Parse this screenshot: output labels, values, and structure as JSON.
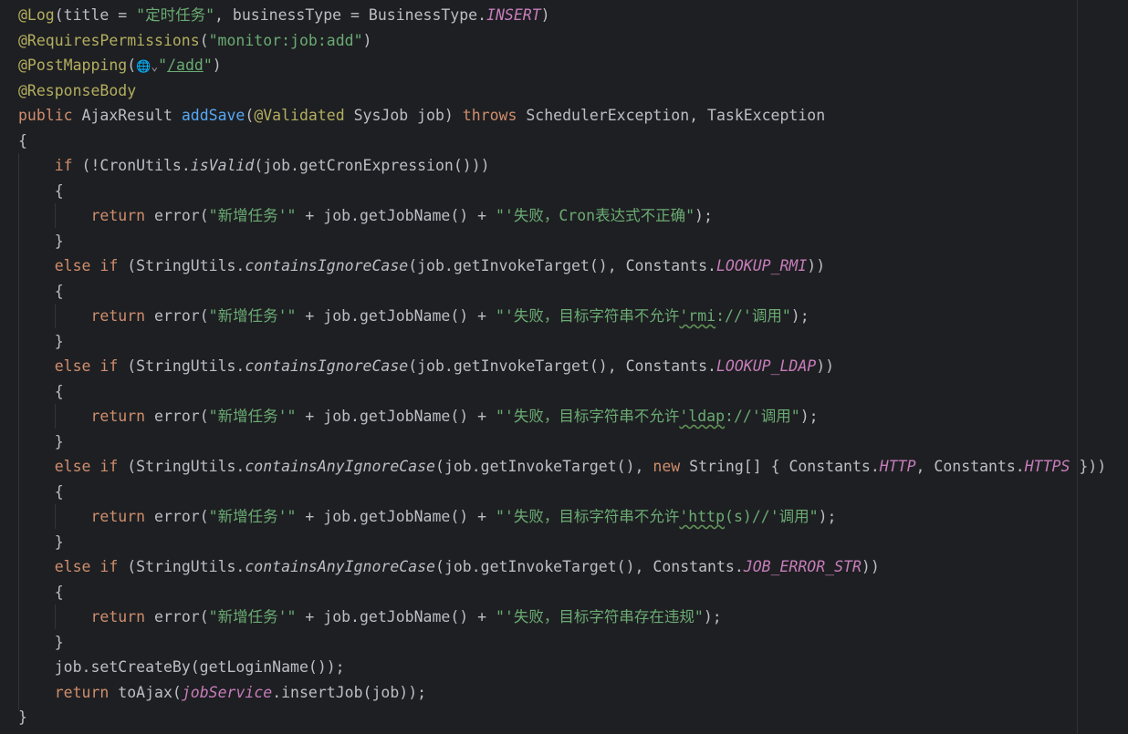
{
  "editor": {
    "theme_colors": {
      "background": "#1e1f22",
      "text": "#bcbec4",
      "keyword": "#cf8e6d",
      "string": "#6aab73",
      "annotation": "#b3ae60",
      "field": "#c77dbb",
      "method_declaration": "#56a8f5"
    },
    "icons": {
      "inlay_web": "globe-icon",
      "inlay_dropdown": "chevron-down-icon"
    },
    "inlay_hint_glyphs": {
      "globe": "🌐",
      "chevron": "⌄"
    }
  },
  "code_lines": [
    [
      [
        "ann",
        "@Log"
      ],
      [
        "p",
        "(title = "
      ],
      [
        "str",
        "\"定时任务\""
      ],
      [
        "p",
        ", businessType = BusinessType."
      ],
      [
        "field",
        "INSERT"
      ],
      [
        "p",
        ")"
      ]
    ],
    [
      [
        "ann",
        "@RequiresPermissions"
      ],
      [
        "p",
        "("
      ],
      [
        "str",
        "\"monitor:job:add\""
      ],
      [
        "p",
        ")"
      ]
    ],
    [
      [
        "ann",
        "@PostMapping"
      ],
      [
        "p",
        "("
      ],
      [
        "icon",
        "globe"
      ],
      [
        "icon",
        "chevron"
      ],
      [
        "str",
        "\""
      ],
      [
        "link",
        "/add"
      ],
      [
        "str",
        "\""
      ],
      [
        "p",
        ")"
      ]
    ],
    [
      [
        "ann",
        "@ResponseBody"
      ]
    ],
    [
      [
        "kw",
        "public"
      ],
      [
        "p",
        " AjaxResult "
      ],
      [
        "fn",
        "addSave"
      ],
      [
        "p",
        "("
      ],
      [
        "ann",
        "@Validated"
      ],
      [
        "p",
        " SysJob job) "
      ],
      [
        "kw",
        "throws"
      ],
      [
        "p",
        " SchedulerException, TaskException"
      ]
    ],
    [
      [
        "p",
        "{"
      ]
    ],
    [
      [
        "p",
        "    "
      ],
      [
        "kw",
        "if"
      ],
      [
        "p",
        " (!CronUtils."
      ],
      [
        "ital",
        "isValid"
      ],
      [
        "p",
        "(job.getCronExpression()))"
      ]
    ],
    [
      [
        "p",
        "    {"
      ]
    ],
    [
      [
        "p",
        "        "
      ],
      [
        "kw",
        "return"
      ],
      [
        "p",
        " error("
      ],
      [
        "str",
        "\"新增任务'\""
      ],
      [
        "p",
        " + job.getJobName() + "
      ],
      [
        "str",
        "\"'失败，Cron表达式不正确\""
      ],
      [
        "p",
        ");"
      ]
    ],
    [
      [
        "p",
        "    }"
      ]
    ],
    [
      [
        "p",
        "    "
      ],
      [
        "kw",
        "else if"
      ],
      [
        "p",
        " (StringUtils."
      ],
      [
        "ital",
        "containsIgnoreCase"
      ],
      [
        "p",
        "(job.getInvokeTarget(), Constants."
      ],
      [
        "field",
        "LOOKUP_RMI"
      ],
      [
        "p",
        "))"
      ]
    ],
    [
      [
        "p",
        "    {"
      ]
    ],
    [
      [
        "p",
        "        "
      ],
      [
        "kw",
        "return"
      ],
      [
        "p",
        " error("
      ],
      [
        "str",
        "\"新增任务'\""
      ],
      [
        "p",
        " + job.getJobName() + "
      ],
      [
        "str",
        "\"'失败，目标字符串不允许"
      ],
      [
        "typo",
        "'rmi"
      ],
      [
        "str",
        "://'调用\""
      ],
      [
        "p",
        ");"
      ]
    ],
    [
      [
        "p",
        "    }"
      ]
    ],
    [
      [
        "p",
        "    "
      ],
      [
        "kw",
        "else if"
      ],
      [
        "p",
        " (StringUtils."
      ],
      [
        "ital",
        "containsIgnoreCase"
      ],
      [
        "p",
        "(job.getInvokeTarget(), Constants."
      ],
      [
        "field",
        "LOOKUP_LDAP"
      ],
      [
        "p",
        "))"
      ]
    ],
    [
      [
        "p",
        "    {"
      ]
    ],
    [
      [
        "p",
        "        "
      ],
      [
        "kw",
        "return"
      ],
      [
        "p",
        " error("
      ],
      [
        "str",
        "\"新增任务'\""
      ],
      [
        "p",
        " + job.getJobName() + "
      ],
      [
        "str",
        "\"'失败，目标字符串不允许"
      ],
      [
        "typo",
        "'ldap"
      ],
      [
        "str",
        "://'调用\""
      ],
      [
        "p",
        ");"
      ]
    ],
    [
      [
        "p",
        "    }"
      ]
    ],
    [
      [
        "p",
        "    "
      ],
      [
        "kw",
        "else if"
      ],
      [
        "p",
        " (StringUtils."
      ],
      [
        "ital",
        "containsAnyIgnoreCase"
      ],
      [
        "p",
        "(job.getInvokeTarget(), "
      ],
      [
        "kw",
        "new"
      ],
      [
        "p",
        " String[] { Constants."
      ],
      [
        "field",
        "HTTP"
      ],
      [
        "p",
        ", Constants."
      ],
      [
        "field",
        "HTTPS"
      ],
      [
        "p",
        " }))"
      ]
    ],
    [
      [
        "p",
        "    {"
      ]
    ],
    [
      [
        "p",
        "        "
      ],
      [
        "kw",
        "return"
      ],
      [
        "p",
        " error("
      ],
      [
        "str",
        "\"新增任务'\""
      ],
      [
        "p",
        " + job.getJobName() + "
      ],
      [
        "str",
        "\"'失败，目标字符串不允许"
      ],
      [
        "typo",
        "'http"
      ],
      [
        "str",
        "(s)//'调用\""
      ],
      [
        "p",
        ");"
      ]
    ],
    [
      [
        "p",
        "    }"
      ]
    ],
    [
      [
        "p",
        "    "
      ],
      [
        "kw",
        "else if"
      ],
      [
        "p",
        " (StringUtils."
      ],
      [
        "ital",
        "containsAnyIgnoreCase"
      ],
      [
        "p",
        "(job.getInvokeTarget(), Constants."
      ],
      [
        "field",
        "JOB_ERROR_STR"
      ],
      [
        "p",
        "))"
      ]
    ],
    [
      [
        "p",
        "    {"
      ]
    ],
    [
      [
        "p",
        "        "
      ],
      [
        "kw",
        "return"
      ],
      [
        "p",
        " error("
      ],
      [
        "str",
        "\"新增任务'\""
      ],
      [
        "p",
        " + job.getJobName() + "
      ],
      [
        "str",
        "\"'失败，目标字符串存在违规\""
      ],
      [
        "p",
        ");"
      ]
    ],
    [
      [
        "p",
        "    }"
      ]
    ],
    [
      [
        "p",
        "    job.setCreateBy(getLoginName());"
      ]
    ],
    [
      [
        "p",
        "    "
      ],
      [
        "kw",
        "return"
      ],
      [
        "p",
        " toAjax("
      ],
      [
        "field2",
        "jobService"
      ],
      [
        "p",
        ".insertJob(job));"
      ]
    ],
    [
      [
        "p",
        "}"
      ]
    ]
  ]
}
